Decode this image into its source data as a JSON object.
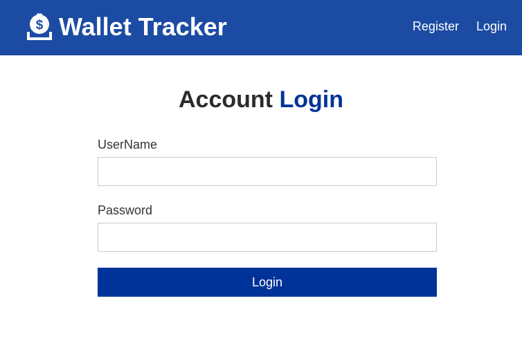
{
  "navbar": {
    "brand_icon": "money-bag-icon",
    "brand_text": "Wallet Tracker",
    "links": [
      {
        "label": "Register"
      },
      {
        "label": "Login"
      }
    ],
    "background_color": "#1c4ba3"
  },
  "main": {
    "heading_part1": "Account",
    "heading_part2": "Login",
    "heading_accent_color": "#003399",
    "form": {
      "username_label": "UserName",
      "username_value": "",
      "username_placeholder": "",
      "password_label": "Password",
      "password_value": "",
      "password_placeholder": "",
      "submit_label": "Login",
      "submit_color": "#003399"
    }
  }
}
